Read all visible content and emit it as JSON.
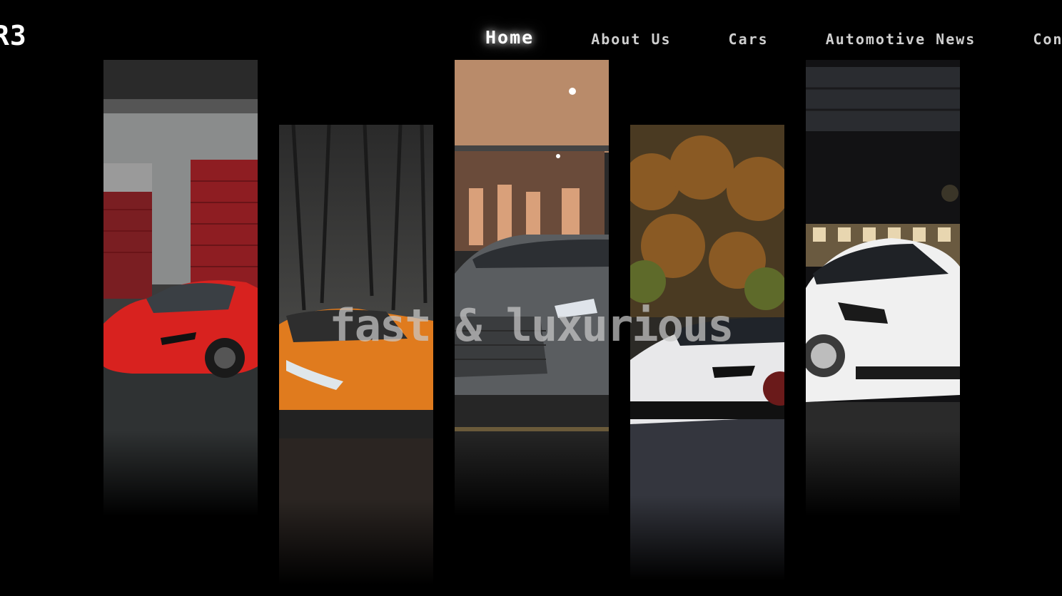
{
  "logo": {
    "text": "R3"
  },
  "nav": {
    "items": [
      {
        "label": "Home",
        "active": true
      },
      {
        "label": "About Us",
        "active": false
      },
      {
        "label": "Cars",
        "active": false
      },
      {
        "label": "Automotive News",
        "active": false
      },
      {
        "label": "Contact",
        "active": false
      }
    ]
  },
  "hero": {
    "title": "fast & luxurious"
  },
  "gallery": {
    "panels": [
      {
        "car": "red sports car",
        "body_color": "#d8221f",
        "backdrop": "garage"
      },
      {
        "car": "orange supercar",
        "body_color": "#e07b1e",
        "backdrop": "forest"
      },
      {
        "car": "grey grand tourer",
        "body_color": "#5a5d60",
        "backdrop": "showroom"
      },
      {
        "car": "white supercar",
        "body_color": "#e8e8ea",
        "backdrop": "autumn road"
      },
      {
        "car": "white sedan",
        "body_color": "#f0f0f0",
        "backdrop": "night station"
      }
    ]
  },
  "colors": {
    "background": "#000000",
    "nav_text": "#cfcfcf",
    "nav_active": "#ffffff"
  }
}
